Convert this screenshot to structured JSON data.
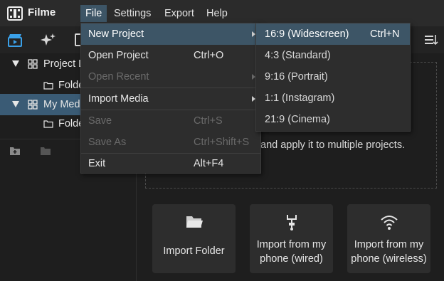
{
  "app": {
    "name": "Filme"
  },
  "menubar": {
    "items": [
      "File",
      "Settings",
      "Export",
      "Help"
    ]
  },
  "tree": {
    "rows": [
      {
        "label": "Project Library"
      },
      {
        "label": "Folder"
      },
      {
        "label": "My Media"
      },
      {
        "label": "Folder"
      }
    ]
  },
  "drop_zone": {
    "text": "and apply it to multiple projects."
  },
  "import_cards": [
    {
      "label": "Import Folder"
    },
    {
      "label": "Import from my\nphone (wired)"
    },
    {
      "label": "Import from my\nphone (wireless)"
    }
  ],
  "file_menu": {
    "items": [
      {
        "label": "New Project",
        "shortcut": "",
        "state": "highlighted",
        "submenu": true
      },
      {
        "label": "Open Project",
        "shortcut": "Ctrl+O",
        "state": "enabled",
        "submenu": false
      },
      {
        "label": "Open Recent",
        "shortcut": "",
        "state": "disabled",
        "submenu": true
      },
      {
        "label": "Import Media",
        "shortcut": "",
        "state": "enabled",
        "submenu": true
      },
      {
        "label": "Save",
        "shortcut": "Ctrl+S",
        "state": "disabled",
        "submenu": false
      },
      {
        "label": "Save As",
        "shortcut": "Ctrl+Shift+S",
        "state": "disabled",
        "submenu": false
      },
      {
        "label": "Exit",
        "shortcut": "Alt+F4",
        "state": "enabled",
        "submenu": false
      }
    ]
  },
  "new_project_submenu": {
    "items": [
      {
        "label": "16:9 (Widescreen)",
        "shortcut": "Ctrl+N"
      },
      {
        "label": "4:3 (Standard)",
        "shortcut": ""
      },
      {
        "label": "9:16 (Portrait)",
        "shortcut": ""
      },
      {
        "label": "1:1 (Instagram)",
        "shortcut": ""
      },
      {
        "label": "21:9 (Cinema)",
        "shortcut": ""
      }
    ]
  },
  "icons": {
    "logo": "film-logo-icon",
    "toolbar": [
      "media-clapper-icon",
      "effects-sparkle-icon",
      "image-icon",
      "list-sort-icon"
    ],
    "left_panel": [
      "add-folder-icon",
      "folder-icon"
    ],
    "cards": [
      "open-folder-icon",
      "usb-icon",
      "wifi-icon"
    ]
  },
  "colors": {
    "accent_highlight": "#3d5566",
    "selection": "#3a5b75",
    "toolbar_accent": "#3aa0e8",
    "background": "#1e1e1e"
  }
}
